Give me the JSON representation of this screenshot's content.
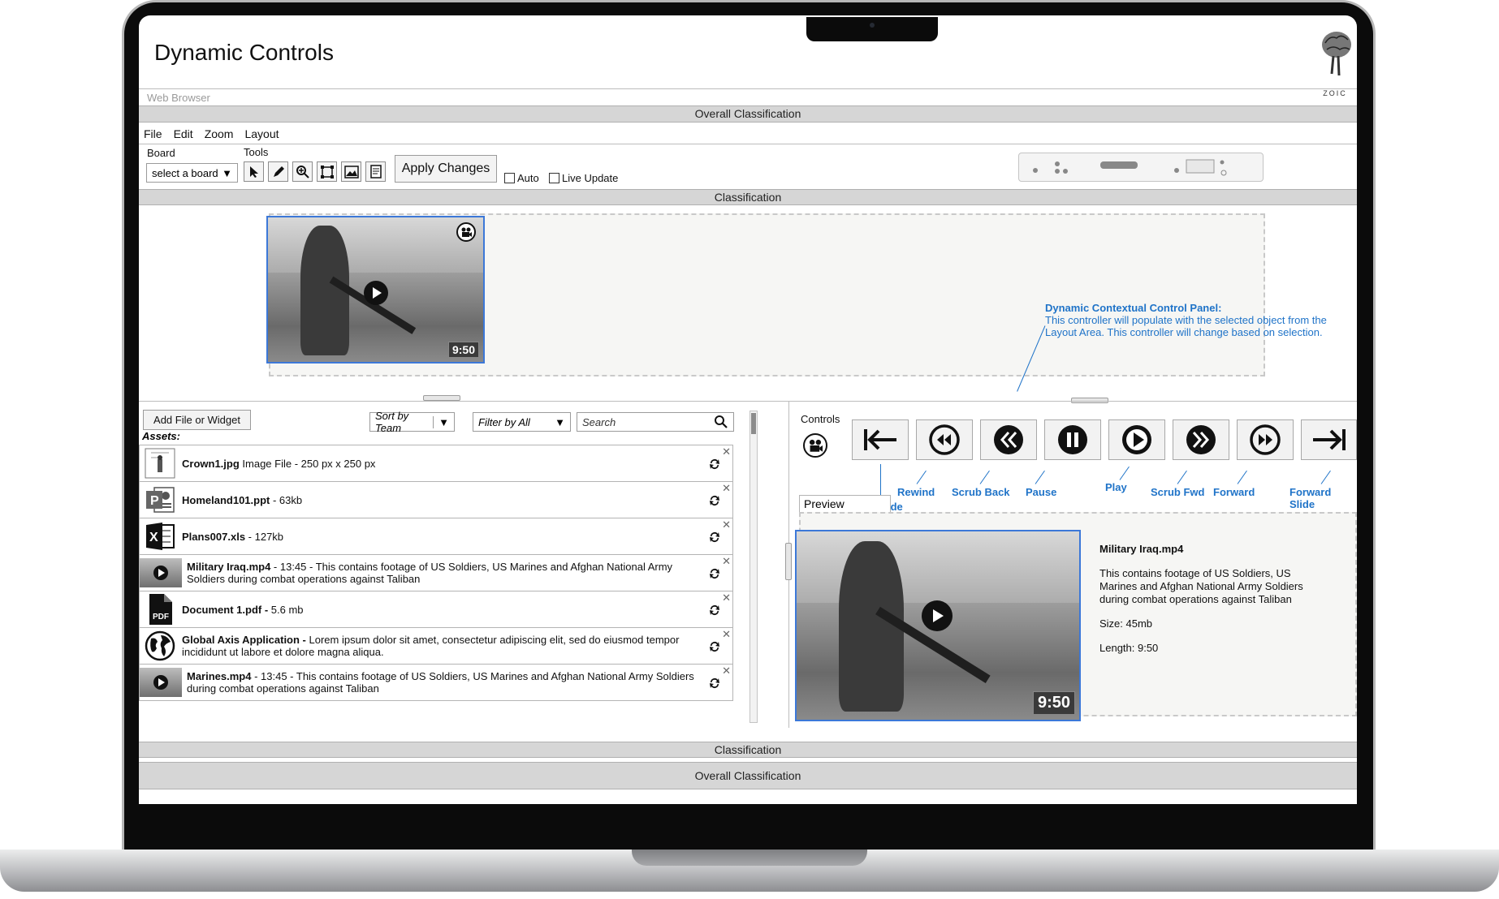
{
  "app": {
    "title": "Dynamic Controls",
    "logo_text": "ZOIC",
    "web_browser_label": "Web Browser"
  },
  "classification": {
    "overall_top": "Overall Classification",
    "classification_top": "Classification",
    "classification_bottom": "Classification",
    "overall_bottom": "Overall Classification"
  },
  "menu": {
    "items": [
      "File",
      "Edit",
      "Zoom",
      "Layout"
    ]
  },
  "toolbar": {
    "board_label": "Board",
    "board_select": "select a board",
    "tools_label": "Tools",
    "tool_icons": [
      "pointer-icon",
      "pencil-icon",
      "zoom-icon",
      "resize-icon",
      "image-icon",
      "document-icon"
    ],
    "apply_button": "Apply Changes",
    "auto_label": "Auto",
    "live_update_label": "Live Update"
  },
  "layout_area": {
    "video_duration": "9:50"
  },
  "annotation": {
    "title": "Dynamic Contextual Control Panel:",
    "body": "This controller will populate with the selected object from the Layout Area. This controller will change based on selection."
  },
  "assets_panel": {
    "add_button": "Add  File or Widget",
    "sort_select": "Sort by Team",
    "filter_select": "Filter by All",
    "search_placeholder": "Search",
    "assets_label": "Assets:",
    "items": [
      {
        "name": "Crown1.jpg",
        "desc": " Image File - 250 px x 250 px",
        "icon": "image-file-icon"
      },
      {
        "name": "Homeland101.ppt",
        "desc": " - 63kb",
        "icon": "powerpoint-icon"
      },
      {
        "name": "Plans007.xls",
        "desc": " - 127kb",
        "icon": "excel-icon"
      },
      {
        "name": "Military Iraq.mp4",
        "desc": " - 13:45 - This contains footage of US Soldiers, US Marines and Afghan National Army Soldiers during combat operations against Taliban",
        "icon": "video-thumb-icon"
      },
      {
        "name": "Document 1.pdf -",
        "desc": " 5.6 mb",
        "icon": "pdf-icon"
      },
      {
        "name": "Global Axis Application -",
        "desc": " Lorem ipsum dolor sit amet, consectetur adipiscing elit, sed do eiusmod tempor incididunt ut labore et dolore magna aliqua.",
        "icon": "globe-icon"
      },
      {
        "name": "Marines.mp4",
        "desc": " - 13:45 - This contains footage of US Soldiers, US Marines and Afghan National Army Soldiers during combat operations against Taliban",
        "icon": "video-thumb-icon"
      }
    ]
  },
  "controls_panel": {
    "label": "Controls",
    "buttons": [
      {
        "label": "Back Slide",
        "icon": "back-slide-icon"
      },
      {
        "label": "Rewind",
        "icon": "rewind-icon"
      },
      {
        "label": "Scrub Back",
        "icon": "scrub-back-icon"
      },
      {
        "label": "Pause",
        "icon": "pause-icon"
      },
      {
        "label": "Play",
        "icon": "play-icon"
      },
      {
        "label": "Scrub Fwd",
        "icon": "scrub-fwd-icon"
      },
      {
        "label": "Forward",
        "icon": "forward-icon"
      },
      {
        "label": "Forward Slide",
        "icon": "forward-slide-icon"
      }
    ],
    "preview_label": "Preview Window",
    "preview": {
      "title": "Military Iraq.mp4",
      "description": "This contains footage of US Soldiers, US Marines and Afghan National Army Soldiers during combat operations against Taliban",
      "size": "Size: 45mb",
      "length": "Length: 9:50",
      "duration": "9:50"
    }
  },
  "colors": {
    "accent": "#1f73c8",
    "selection": "#3c78d8",
    "classification_bar": "#d6d6d6"
  }
}
